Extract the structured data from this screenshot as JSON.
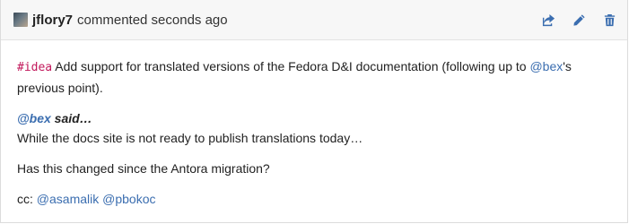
{
  "comment": {
    "author": "jflory7",
    "meta": "commented seconds ago",
    "actions": [
      {
        "name": "reply",
        "icon": "share-icon"
      },
      {
        "name": "edit",
        "icon": "pencil-icon"
      },
      {
        "name": "delete",
        "icon": "trash-icon"
      }
    ],
    "body": {
      "tag": "#idea",
      "intro": " Add support for translated versions of the Fedora D&I documentation (following up to ",
      "intro_mention": "@bex",
      "intro_end": "'s previous point).",
      "quote_mention": "@bex",
      "quote_said": " said…",
      "quote_text": "While the docs site is not ready to publish translations today…",
      "question": "Has this changed since the Antora migration?",
      "cc_label": "cc: ",
      "cc_mentions": [
        "@asamalik",
        "@pbokoc"
      ]
    }
  },
  "colors": {
    "link": "#3b6eb0",
    "tag": "#c2185b",
    "header_bg": "#f7f7f7"
  }
}
